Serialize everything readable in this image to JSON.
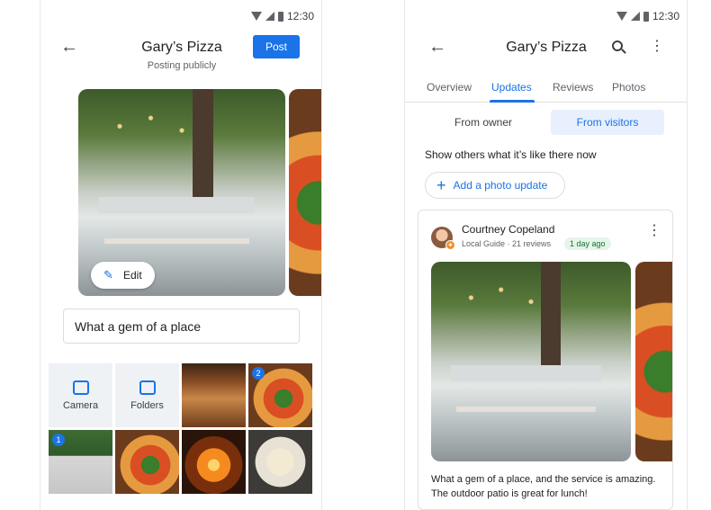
{
  "status_bar": {
    "time": "12:30"
  },
  "compose": {
    "title": "Gary’s Pizza",
    "subtitle": "Posting publicly",
    "post_label": "Post",
    "edit_label": "Edit",
    "input_value": "What a gem of a place",
    "camera_label": "Camera",
    "folders_label": "Folders",
    "badge_1": "1",
    "badge_2": "2"
  },
  "place": {
    "title": "Gary’s Pizza",
    "tabs": [
      {
        "label": "Overview"
      },
      {
        "label": "Updates"
      },
      {
        "label": "Reviews"
      },
      {
        "label": "Photos"
      }
    ],
    "segments": {
      "owner": "From owner",
      "visitors": "From visitors"
    },
    "helper_text": "Show others what it’s like there now",
    "add_photo_label": "Add a photo update",
    "card": {
      "author": "Courtney Copeland",
      "meta": "Local Guide · 21 reviews",
      "time": "1 day ago",
      "text": "What a gem of a place, and the service is amazing. The outdoor patio is great for lunch!"
    }
  },
  "colors": {
    "accent": "#1a73e8",
    "tab_active": "#1a73e8",
    "segment_active_bg": "#e8f0fe",
    "time_badge_bg": "#e6f4ea"
  }
}
